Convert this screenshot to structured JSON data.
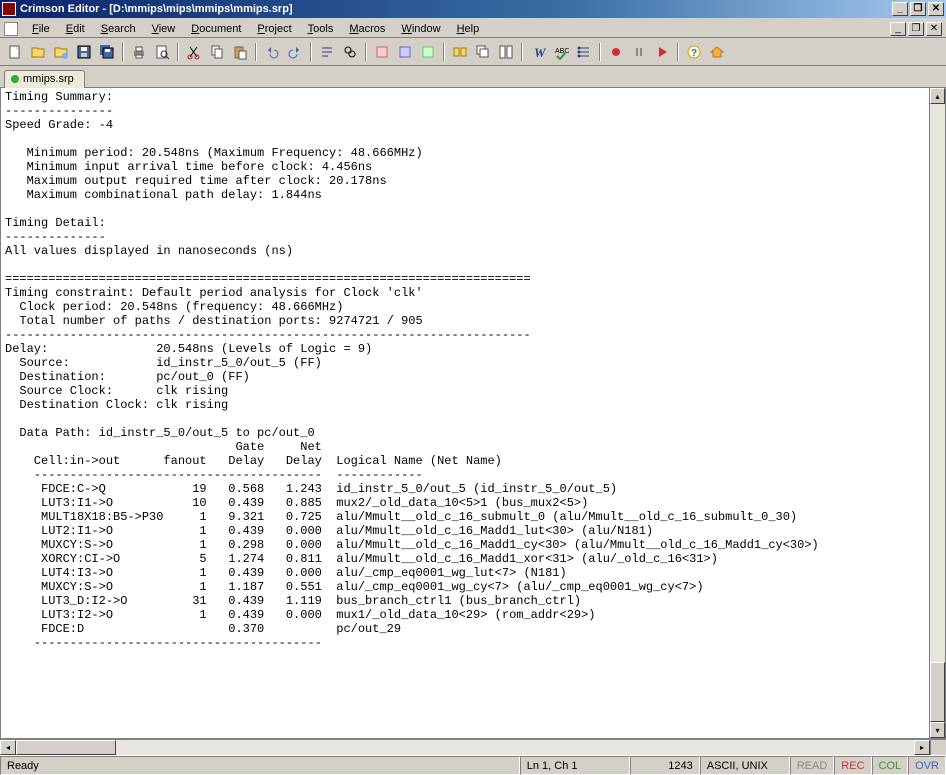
{
  "window": {
    "title": "Crimson Editor - [D:\\mmips\\mips\\mmips\\mmips.srp]",
    "min_label": "_",
    "max_label": "❐",
    "close_label": "✕"
  },
  "menu": {
    "file": "File",
    "edit": "Edit",
    "search": "Search",
    "view": "View",
    "document": "Document",
    "project": "Project",
    "tools": "Tools",
    "macros": "Macros",
    "window": "Window",
    "help": "Help"
  },
  "tab": {
    "filename": "mmips.srp"
  },
  "editor_text": "Timing Summary:\n---------------\nSpeed Grade: -4\n\n   Minimum period: 20.548ns (Maximum Frequency: 48.666MHz)\n   Minimum input arrival time before clock: 4.456ns\n   Maximum output required time after clock: 20.178ns\n   Maximum combinational path delay: 1.844ns\n\nTiming Detail:\n--------------\nAll values displayed in nanoseconds (ns)\n\n=========================================================================\nTiming constraint: Default period analysis for Clock 'clk'\n  Clock period: 20.548ns (frequency: 48.666MHz)\n  Total number of paths / destination ports: 9274721 / 905\n-------------------------------------------------------------------------\nDelay:               20.548ns (Levels of Logic = 9)\n  Source:            id_instr_5_0/out_5 (FF)\n  Destination:       pc/out_0 (FF)\n  Source Clock:      clk rising\n  Destination Clock: clk rising\n\n  Data Path: id_instr_5_0/out_5 to pc/out_0\n                                Gate     Net\n    Cell:in->out      fanout   Delay   Delay  Logical Name (Net Name)\n    ----------------------------------------  ------------\n     FDCE:C->Q            19   0.568   1.243  id_instr_5_0/out_5 (id_instr_5_0/out_5)\n     LUT3:I1->O           10   0.439   0.885  mux2/_old_data_10<5>1 (bus_mux2<5>)\n     MULT18X18:B5->P30     1   9.321   0.725  alu/Mmult__old_c_16_submult_0 (alu/Mmult__old_c_16_submult_0_30)\n     LUT2:I1->O            1   0.439   0.000  alu/Mmult__old_c_16_Madd1_lut<30> (alu/N181)\n     MUXCY:S->O            1   0.298   0.000  alu/Mmult__old_c_16_Madd1_cy<30> (alu/Mmult__old_c_16_Madd1_cy<30>)\n     XORCY:CI->O           5   1.274   0.811  alu/Mmult__old_c_16_Madd1_xor<31> (alu/_old_c_16<31>)\n     LUT4:I3->O            1   0.439   0.000  alu/_cmp_eq0001_wg_lut<7> (N181)\n     MUXCY:S->O            1   1.187   0.551  alu/_cmp_eq0001_wg_cy<7> (alu/_cmp_eq0001_wg_cy<7>)\n     LUT3_D:I2->O         31   0.439   1.119  bus_branch_ctrl1 (bus_branch_ctrl)\n     LUT3:I2->O            1   0.439   0.000  mux1/_old_data_10<29> (rom_addr<29>)\n     FDCE:D                    0.370          pc/out_29\n    ----------------------------------------",
  "status": {
    "ready": "Ready",
    "cursor": "Ln 1, Ch 1",
    "chars": "1243",
    "encoding": "ASCII, UNIX",
    "read": "READ",
    "rec": "REC",
    "col": "COL",
    "ovr": "OVR"
  }
}
